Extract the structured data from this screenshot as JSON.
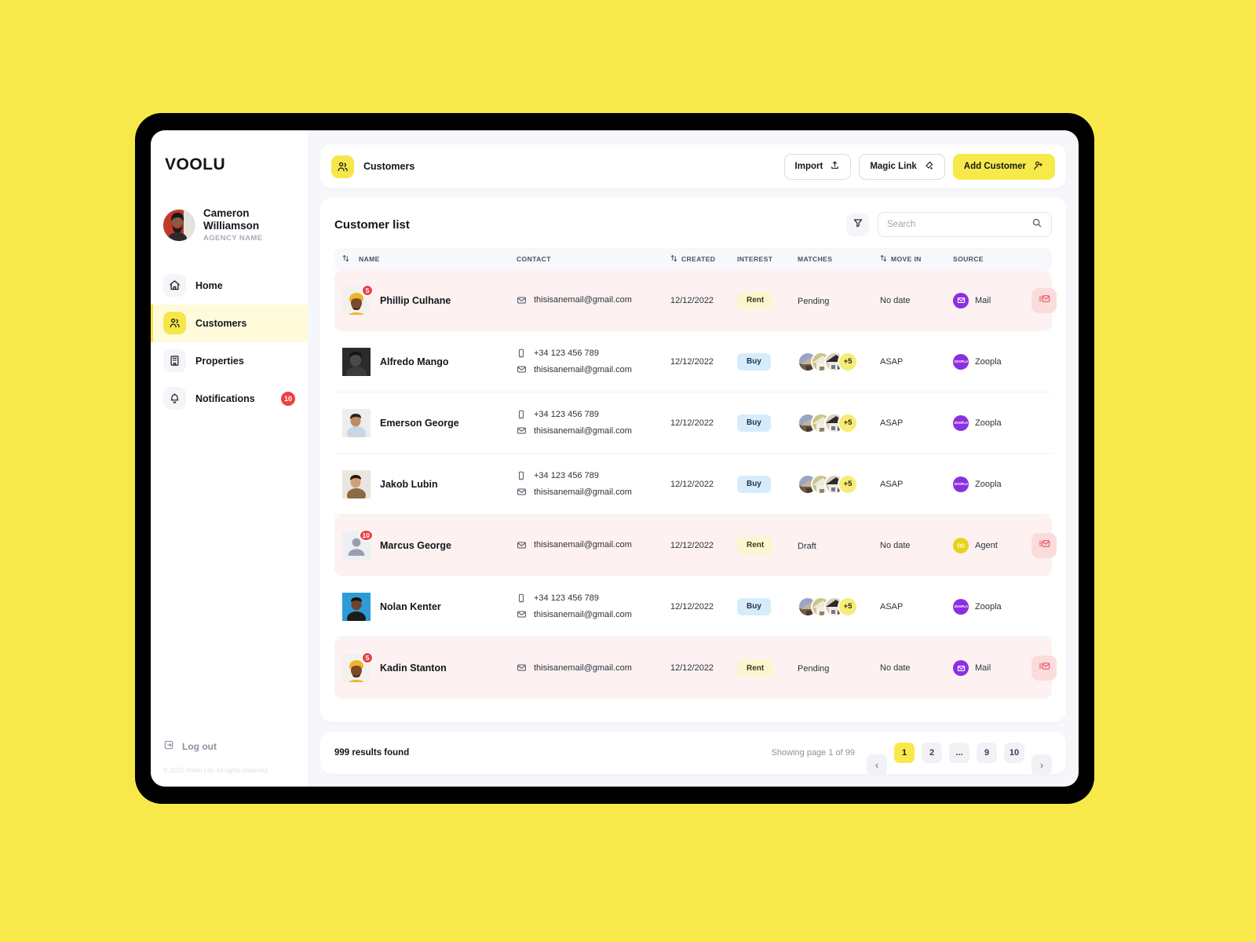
{
  "brand": {
    "name": "VOOLU"
  },
  "sidebar": {
    "profile": {
      "name": "Cameron Williamson",
      "agency": "AGENCY NAME",
      "avatar_icon": "user-avatar"
    },
    "items": [
      {
        "label": "Home",
        "icon": "home-icon",
        "active": false,
        "badge": ""
      },
      {
        "label": "Customers",
        "icon": "users-icon",
        "active": true,
        "badge": ""
      },
      {
        "label": "Properties",
        "icon": "building-icon",
        "active": false,
        "badge": ""
      },
      {
        "label": "Notifications",
        "icon": "bell-icon",
        "active": false,
        "badge": "10"
      }
    ],
    "logout": {
      "label": "Log out",
      "icon": "logout-icon"
    },
    "copyright": "© 2022 Voolu Ltd. All rights reserved"
  },
  "topbar": {
    "icon": "users-icon",
    "title": "Customers",
    "buttons": [
      {
        "label": "Import",
        "icon": "upload-icon",
        "style": "ghost"
      },
      {
        "label": "Magic Link",
        "icon": "link-icon",
        "style": "ghost"
      },
      {
        "label": "Add Customer",
        "icon": "user-plus-icon",
        "style": "primary"
      }
    ]
  },
  "panel": {
    "title": "Customer list",
    "filter_icon": "filter-icon",
    "search": {
      "placeholder": "Search",
      "value": "",
      "icon": "search-icon"
    },
    "columns": [
      {
        "label": "NAME",
        "sortable": true
      },
      {
        "label": "CONTACT",
        "sortable": false
      },
      {
        "label": "CREATED",
        "sortable": true
      },
      {
        "label": "INTEREST",
        "sortable": false
      },
      {
        "label": "MATCHES",
        "sortable": false
      },
      {
        "label": "MOVE IN",
        "sortable": true
      },
      {
        "label": "SOURCE",
        "sortable": false
      }
    ],
    "rows": [
      {
        "name": "Phillip Culhane",
        "avatar_badge": "5",
        "avatar_style": "turban",
        "phone": "",
        "email": "thisisanemail@gmail.com",
        "created": "12/12/2022",
        "interest": "Rent",
        "interest_kind": "rent",
        "matches_count": "",
        "matches_text": "Pending",
        "move_in": "No date",
        "source": "Mail",
        "source_kind": "mail",
        "flagged": true,
        "action_icon": "send-mail-icon"
      },
      {
        "name": "Alfredo Mango",
        "avatar_badge": "",
        "avatar_style": "dark",
        "phone": "+34 123 456 789",
        "email": "thisisanemail@gmail.com",
        "created": "12/12/2022",
        "interest": "Buy",
        "interest_kind": "buy",
        "matches_count": "+5",
        "matches_text": "",
        "move_in": "ASAP",
        "source": "Zoopla",
        "source_kind": "zoopla",
        "flagged": false,
        "action_icon": ""
      },
      {
        "name": "Emerson George",
        "avatar_badge": "",
        "avatar_style": "light",
        "phone": "+34 123 456 789",
        "email": "thisisanemail@gmail.com",
        "created": "12/12/2022",
        "interest": "Buy",
        "interest_kind": "buy",
        "matches_count": "+5",
        "matches_text": "",
        "move_in": "ASAP",
        "source": "Zoopla",
        "source_kind": "zoopla",
        "flagged": false,
        "action_icon": ""
      },
      {
        "name": "Jakob Lubin",
        "avatar_badge": "",
        "avatar_style": "tan",
        "phone": "+34 123 456 789",
        "email": "thisisanemail@gmail.com",
        "created": "12/12/2022",
        "interest": "Buy",
        "interest_kind": "buy",
        "matches_count": "+5",
        "matches_text": "",
        "move_in": "ASAP",
        "source": "Zoopla",
        "source_kind": "zoopla",
        "flagged": false,
        "action_icon": ""
      },
      {
        "name": "Marcus George",
        "avatar_badge": "10",
        "avatar_style": "placeholder",
        "phone": "",
        "email": "thisisanemail@gmail.com",
        "created": "12/12/2022",
        "interest": "Rent",
        "interest_kind": "rent",
        "matches_count": "",
        "matches_text": "Draft",
        "move_in": "No date",
        "source": "Agent",
        "source_kind": "agent",
        "flagged": true,
        "action_icon": "send-mail-icon"
      },
      {
        "name": "Nolan Kenter",
        "avatar_badge": "",
        "avatar_style": "blue",
        "phone": "+34 123 456 789",
        "email": "thisisanemail@gmail.com",
        "created": "12/12/2022",
        "interest": "Buy",
        "interest_kind": "buy",
        "matches_count": "+5",
        "matches_text": "",
        "move_in": "ASAP",
        "source": "Zoopla",
        "source_kind": "zoopla",
        "flagged": false,
        "action_icon": ""
      },
      {
        "name": "Kadin Stanton",
        "avatar_badge": "5",
        "avatar_style": "turban",
        "phone": "",
        "email": "thisisanemail@gmail.com",
        "created": "12/12/2022",
        "interest": "Rent",
        "interest_kind": "rent",
        "matches_count": "",
        "matches_text": "Pending",
        "move_in": "No date",
        "source": "Mail",
        "source_kind": "mail",
        "flagged": true,
        "action_icon": "send-mail-icon"
      }
    ]
  },
  "footer": {
    "results": "999 results found",
    "showing": "Showing page 1 of 99",
    "pages": [
      {
        "label": "‹",
        "kind": "prev",
        "active": false
      },
      {
        "label": "1",
        "kind": "page",
        "active": true
      },
      {
        "label": "2",
        "kind": "page",
        "active": false
      },
      {
        "label": "...",
        "kind": "ellipsis",
        "active": false
      },
      {
        "label": "9",
        "kind": "page",
        "active": false
      },
      {
        "label": "10",
        "kind": "page",
        "active": false
      },
      {
        "label": "›",
        "kind": "next",
        "active": false
      }
    ]
  },
  "colors": {
    "brand_yellow": "#F8E94A",
    "page_background": "#F8E94A",
    "active_nav": "#FFFBDA",
    "flag_row": "#FDF1F1",
    "badge_red": "#EC4044",
    "rent_pill": "#FCF6CF",
    "buy_pill": "#D6ECFB",
    "zoopla_purple": "#8B2FE0",
    "mail_purple": "#8B2FE0",
    "agent_yellow": "#E8D21A"
  }
}
